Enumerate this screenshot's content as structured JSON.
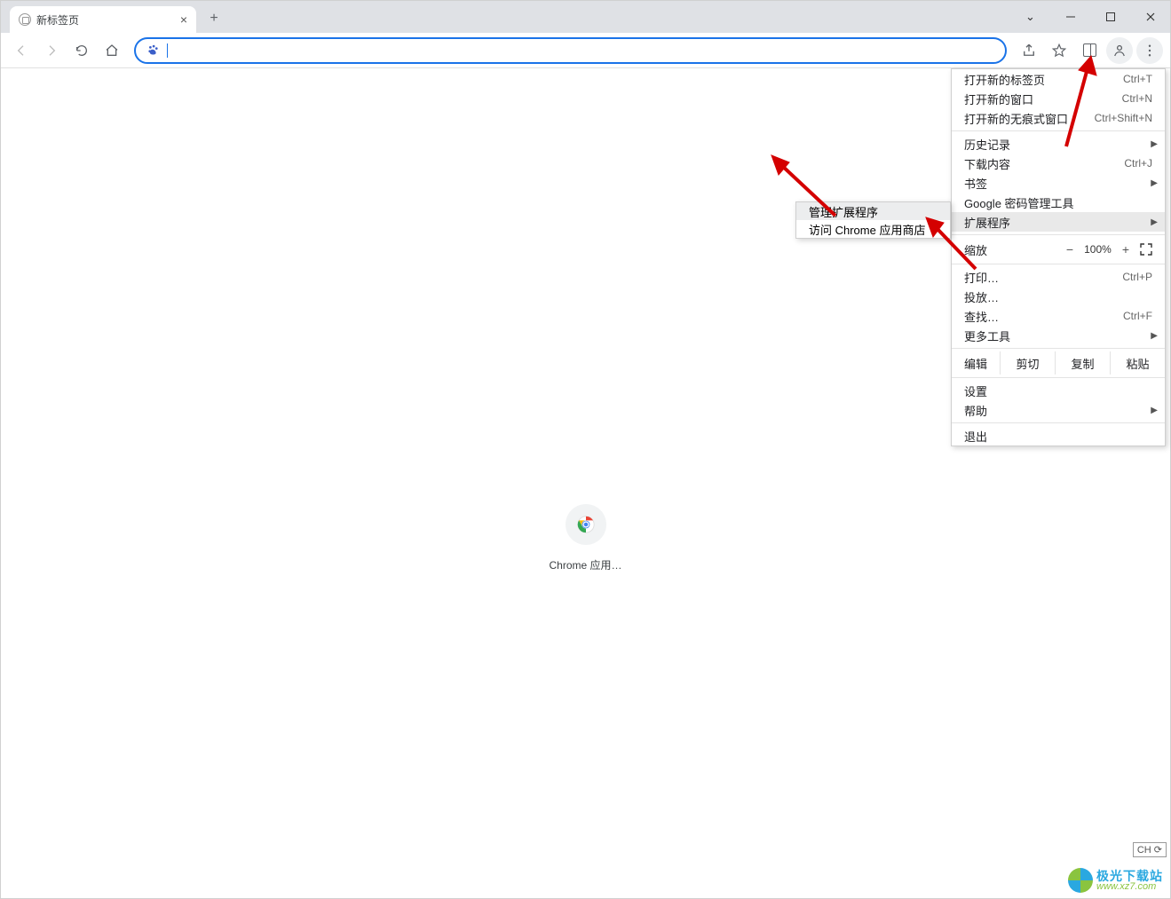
{
  "tab": {
    "title": "新标签页"
  },
  "menu": {
    "new_tab": "打开新的标签页",
    "new_tab_sc": "Ctrl+T",
    "new_window": "打开新的窗口",
    "new_window_sc": "Ctrl+N",
    "new_incognito": "打开新的无痕式窗口",
    "new_incognito_sc": "Ctrl+Shift+N",
    "history": "历史记录",
    "downloads": "下载内容",
    "downloads_sc": "Ctrl+J",
    "bookmarks": "书签",
    "passwords": "Google 密码管理工具",
    "extensions": "扩展程序",
    "zoom_label": "缩放",
    "zoom_value": "100%",
    "print": "打印…",
    "print_sc": "Ctrl+P",
    "cast": "投放…",
    "find": "查找…",
    "find_sc": "Ctrl+F",
    "more_tools": "更多工具",
    "edit_label": "编辑",
    "cut": "剪切",
    "copy": "复制",
    "paste": "粘贴",
    "settings": "设置",
    "help": "帮助",
    "exit": "退出"
  },
  "submenu": {
    "manage_extensions": "管理扩展程序",
    "chrome_web_store": "访问 Chrome 应用商店"
  },
  "shortcut": {
    "label": "Chrome 应用…"
  },
  "watermark": {
    "line1": "极光下载站",
    "line2": "www.xz7.com"
  },
  "ime": {
    "text": "CH ⟳"
  }
}
